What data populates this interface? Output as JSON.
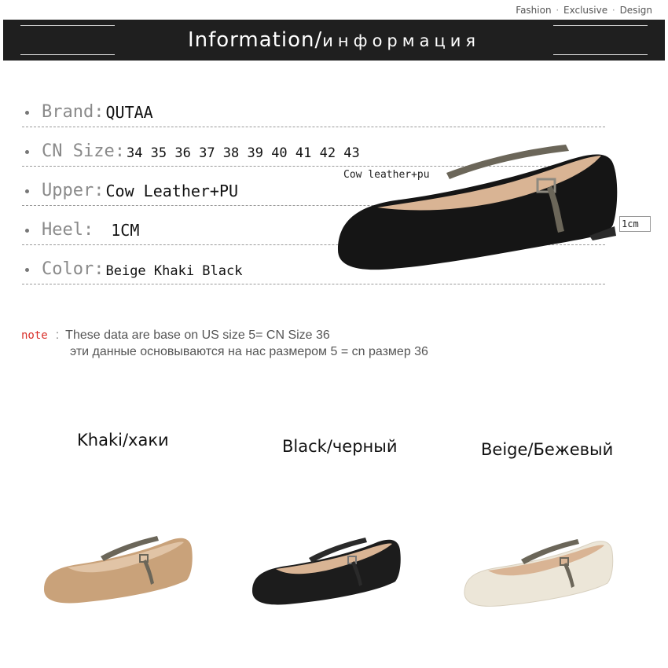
{
  "tagline": [
    "Fashion",
    "Exclusive",
    "Design"
  ],
  "banner": {
    "title_en": "Information/",
    "title_ru": "информация"
  },
  "specs": [
    {
      "label": "Brand:",
      "value": "QUTAA"
    },
    {
      "label": "CN Size:",
      "value": "34 35 36 37 38 39 40 41 42 43"
    },
    {
      "label": "Upper:",
      "value": "Cow Leather+PU"
    },
    {
      "label": "Heel:",
      "value": "1CM"
    },
    {
      "label": "Color:",
      "value": "Beige  Khaki Black"
    }
  ],
  "diagram": {
    "material_callout": "Cow leather+pu",
    "heel_callout": "1cm"
  },
  "note": {
    "label": "note",
    "line_en": "These data are base on US size 5= CN Size 36",
    "line_ru": "эти данные основываются на нас размером 5 = cn размер 36"
  },
  "variants": [
    {
      "caption": "Khaki/хаки",
      "color": "#c9a27a"
    },
    {
      "caption": "Black/черный",
      "color": "#1c1c1c"
    },
    {
      "caption": "Beige/Бежевый",
      "color": "#ece6d8"
    }
  ],
  "colors": {
    "banner": "#1f1f1f",
    "note_label": "#d9302a",
    "strap": "#6b6659",
    "lining": "#d9b494"
  }
}
